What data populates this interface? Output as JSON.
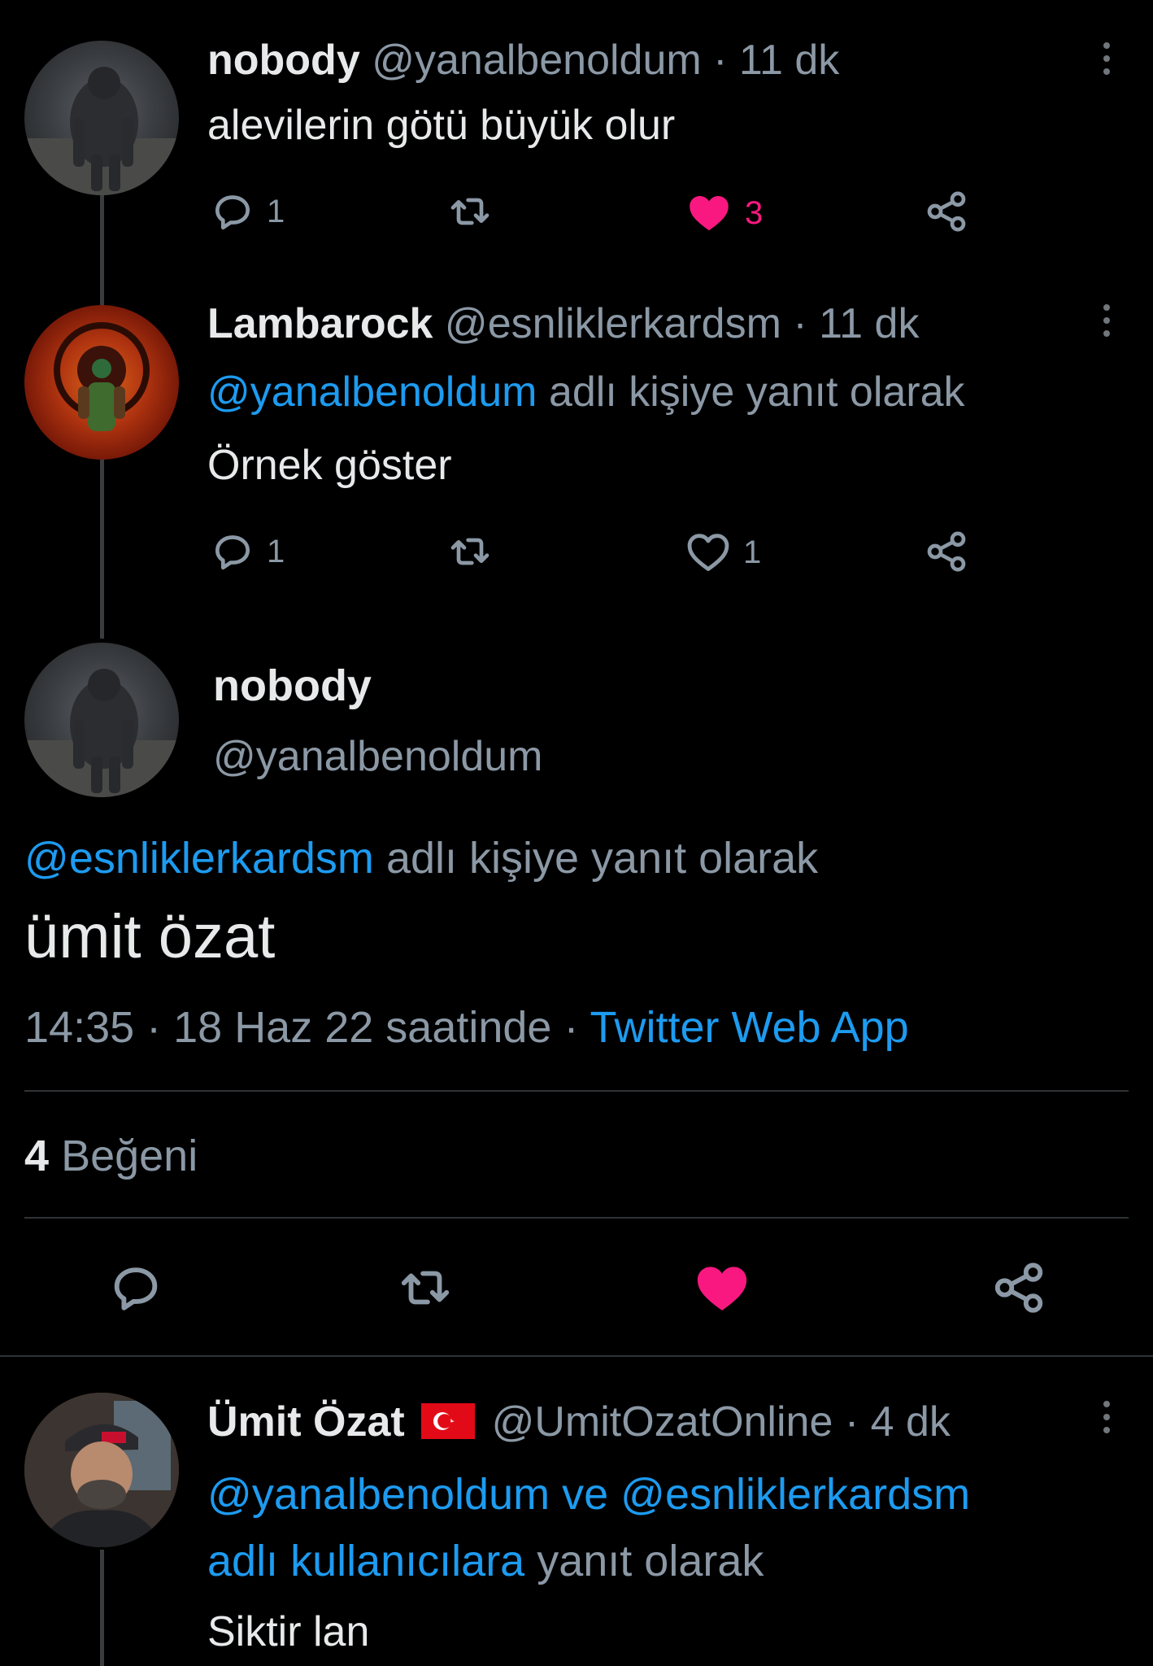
{
  "tweets": [
    {
      "name": "nobody",
      "handle": "@yanalbenoldum",
      "time": "· 11 dk",
      "text": "alevilerin götü büyük olur",
      "reply_count": "1",
      "like_count": "3",
      "liked": true
    },
    {
      "name": "Lambarock",
      "handle": "@esnliklerkardsm",
      "time": "· 11 dk",
      "reply_mention": "@yanalbenoldum",
      "reply_suffix": "adlı kişiye yanıt olarak",
      "text": "Örnek göster",
      "reply_count": "1",
      "like_count": "1",
      "liked": false
    }
  ],
  "main_tweet": {
    "name": "nobody",
    "handle": "@yanalbenoldum",
    "reply_mention": "@esnliklerkardsm",
    "reply_suffix": "adlı kişiye yanıt olarak",
    "text": "ümit özat",
    "timestamp": "14:35 · 18 Haz 22 saatinde ·",
    "source": "Twitter Web App",
    "likes_count": "4",
    "likes_label": "Beğeni",
    "liked": true
  },
  "reply": {
    "name": "Ümit Özat",
    "handle": "@UmitOzatOnline",
    "time": "· 4 dk",
    "mention1": "@yanalbenoldum",
    "connector": "ve",
    "mention2": "@esnliklerkardsm",
    "mention_suffix": "adlı kullanıcılara",
    "reply_suffix": "yanıt olarak",
    "text": "Siktir lan"
  },
  "icons": {
    "reply": "reply-icon",
    "retweet": "retweet-icon",
    "like": "heart-icon",
    "share": "share-icon",
    "more": "more-icon",
    "flag": "turkey-flag-icon"
  },
  "colors": {
    "background": "#000000",
    "link": "#1d9bf0",
    "like": "#f91880",
    "muted": "#8b98a5"
  }
}
